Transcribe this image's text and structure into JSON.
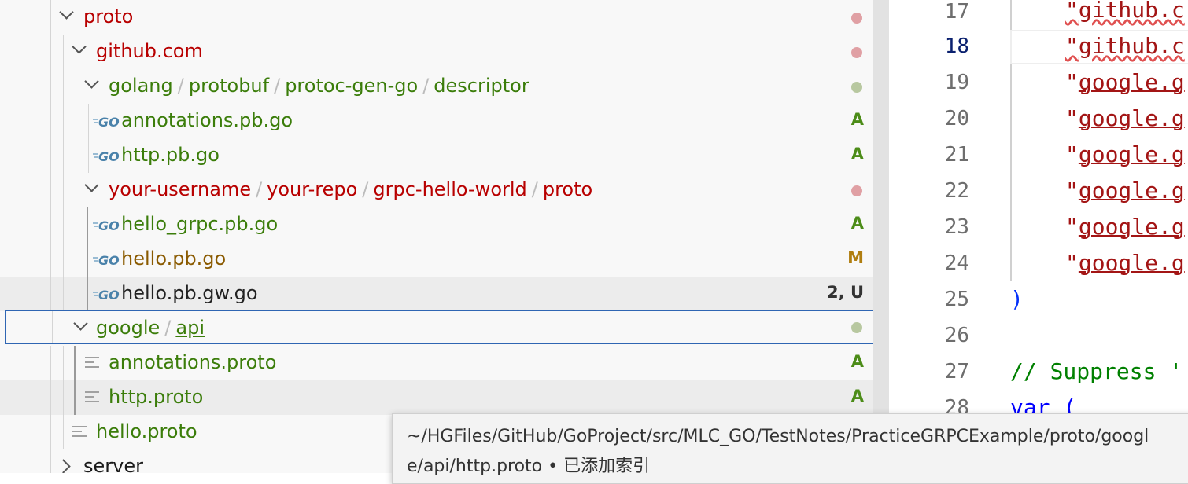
{
  "explorer": {
    "rows": [
      {
        "label": "proto",
        "status": "red-dot"
      },
      {
        "label": "github.com",
        "status": "red-dot"
      },
      {
        "path": [
          "golang",
          "protobuf",
          "protoc-gen-go",
          "descriptor"
        ],
        "status": "green-dot"
      },
      {
        "label": "annotations.pb.go",
        "icon": "go-file-icon",
        "badge": "A"
      },
      {
        "label": "http.pb.go",
        "icon": "go-file-icon",
        "badge": "A"
      },
      {
        "path": [
          "your-username",
          "your-repo",
          "grpc-hello-world",
          "proto"
        ],
        "status": "red-dot"
      },
      {
        "label": "hello_grpc.pb.go",
        "icon": "go-file-icon",
        "badge": "A"
      },
      {
        "label": "hello.pb.go",
        "icon": "go-file-icon",
        "badge": "M"
      },
      {
        "label": "hello.pb.gw.go",
        "icon": "go-file-icon",
        "badge": "2, U"
      },
      {
        "path": [
          "google",
          "api"
        ],
        "status": "green-dot"
      },
      {
        "label": "annotations.proto",
        "icon": "proto-file-icon",
        "badge": "A"
      },
      {
        "label": "http.proto",
        "icon": "proto-file-icon",
        "badge": "A"
      },
      {
        "label": "hello.proto",
        "icon": "proto-file-icon"
      },
      {
        "label": "server"
      }
    ],
    "separator": "/"
  },
  "editor": {
    "line_numbers": [
      "17",
      "18",
      "19",
      "20",
      "21",
      "22",
      "23",
      "24",
      "25",
      "26",
      "27",
      "28"
    ],
    "active_line": "18",
    "lines": [
      {
        "q": "\"",
        "s": "github.c"
      },
      {
        "q": "\"",
        "s": "github.c"
      },
      {
        "q": "\"",
        "s": "google.g"
      },
      {
        "q": "\"",
        "s": "google.g"
      },
      {
        "q": "\"",
        "s": "google.g"
      },
      {
        "q": "\"",
        "s": "google.g"
      },
      {
        "q": "\"",
        "s": "google.g"
      },
      {
        "q": "\"",
        "s": "google.g"
      },
      {
        "text": ")"
      },
      {
        "text": ""
      },
      {
        "text": "// Suppress '"
      },
      {
        "text": "var ("
      }
    ]
  },
  "tooltip": {
    "line1": "~/HGFiles/GitHub/GoProject/src/MLC_GO/TestNotes/PracticeGRPCExample/proto/googl",
    "line2": "e/api/http.proto • 已添加索引"
  },
  "colors": {
    "git_added": "#4c8c18",
    "git_modified": "#b07e10",
    "git_error": "#b80000",
    "selection_border": "#2f66b3"
  }
}
